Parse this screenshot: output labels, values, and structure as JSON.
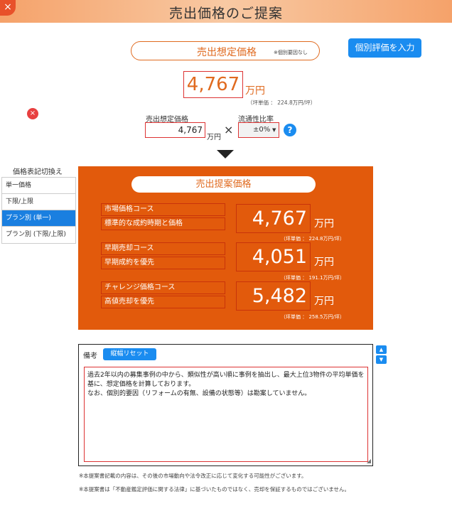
{
  "window": {
    "title": "売出価格のご提案",
    "close_symbol": "×"
  },
  "header": {
    "pill_label": "売出想定価格",
    "pill_note": "※個別要因なし",
    "eval_button": "個別評価を入力"
  },
  "estimate": {
    "value": "4,767",
    "unit": "万円",
    "unit_price_note": "（坪単価 ： 224.8万円/坪）"
  },
  "calc": {
    "close_symbol": "×",
    "price_label": "売出想定価格",
    "price_value": "4,767",
    "price_unit": "万円",
    "times": "×",
    "ratio_label": "流通性比率",
    "ratio_value": "±0%",
    "help": "?"
  },
  "sidebar": {
    "title": "価格表記切換え",
    "items": [
      {
        "label": "単一価格"
      },
      {
        "label": "下限/上限"
      },
      {
        "label": "プラン別 (単一)"
      },
      {
        "label": "プラン別 (下限/上限)"
      }
    ]
  },
  "proposal": {
    "title": "売出提案価格",
    "courses": [
      {
        "name": "市場価格コース",
        "desc": "標準的な成約時期と価格",
        "price": "4,767",
        "unit": "万円",
        "note": "（坪単価 ： 224.8万円/坪）"
      },
      {
        "name": "早期売却コース",
        "desc": "早期成約を優先",
        "price": "4,051",
        "unit": "万円",
        "note": "（坪単価 ： 191.1万円/坪）"
      },
      {
        "name": "チャレンジ価格コース",
        "desc": "高値売却を優先",
        "price": "5,482",
        "unit": "万円",
        "note": "（坪単価 ： 258.5万円/坪）"
      }
    ]
  },
  "remarks": {
    "label": "備考",
    "reset_button": "縦幅リセット",
    "text": "過去2年以内の募集事例の中から、類似性が高い順に事例を抽出し、最大上位3物件の平均単価を基に、想定価格を計算しております。\nなお、個別的要因（リフォームの有無、設備の状態等）は勘案していません。"
  },
  "footnotes": [
    "※本提案書記載の内容は、その後の市場動向や法令改正に応じて変化する可能性がございます。",
    "※本提案書は「不動産鑑定評価に関する法律」に基づいたものではなく、売却を保証するものではございません。"
  ]
}
